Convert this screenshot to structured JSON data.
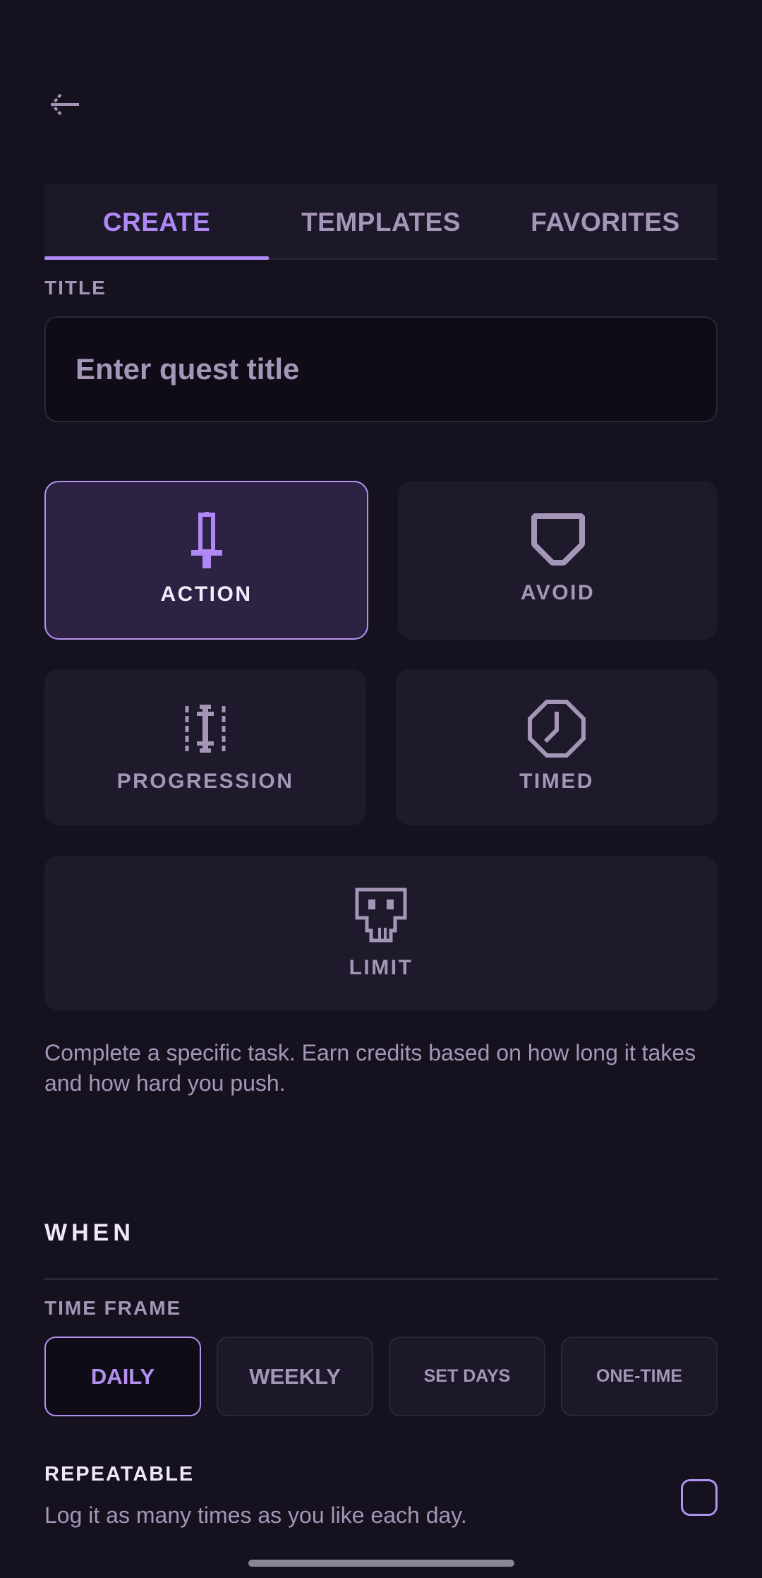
{
  "tabs": [
    {
      "label": "CREATE"
    },
    {
      "label": "TEMPLATES"
    },
    {
      "label": "FAVORITES"
    }
  ],
  "active_tab": "CREATE",
  "title_field": {
    "label": "TITLE",
    "placeholder": "Enter quest title",
    "value": ""
  },
  "quest_types": [
    {
      "label": "ACTION",
      "icon": "sword-icon",
      "selected": true
    },
    {
      "label": "AVOID",
      "icon": "shield-icon",
      "selected": false
    },
    {
      "label": "PROGRESSION",
      "icon": "progression-icon",
      "selected": false
    },
    {
      "label": "TIMED",
      "icon": "clock-icon",
      "selected": false
    },
    {
      "label": "LIMIT",
      "icon": "skull-icon",
      "selected": false
    }
  ],
  "description": "Complete a specific task. Earn credits based on how long it takes and how hard you push.",
  "when": {
    "section_title": "WHEN",
    "time_frame_label": "TIME FRAME",
    "options": [
      {
        "label": "DAILY",
        "selected": true
      },
      {
        "label": "WEEKLY",
        "selected": false
      },
      {
        "label": "SET DAYS",
        "selected": false
      },
      {
        "label": "ONE-TIME",
        "selected": false
      }
    ]
  },
  "repeatable": {
    "title": "REPEATABLE",
    "description": "Log it as many times as you like each day.",
    "checked": false
  },
  "colors": {
    "background": "#15111e",
    "accent": "#b088f5",
    "muted_text": "#a596b8",
    "card": "#1f1a2b",
    "selected_card": "#2d2244"
  }
}
